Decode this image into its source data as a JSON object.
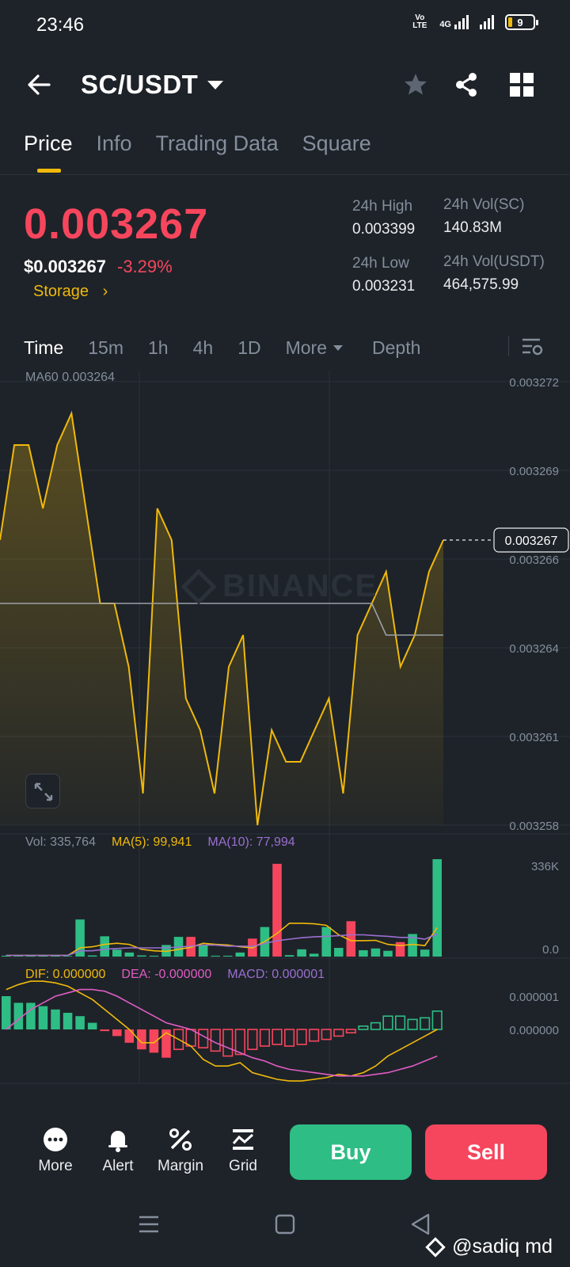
{
  "status_bar": {
    "time": "23:46",
    "network_volte": "Vo LTE",
    "network_type": "4G",
    "battery_level": "9"
  },
  "header": {
    "pair": "SC/USDT"
  },
  "tabs": [
    {
      "label": "Price",
      "active": true
    },
    {
      "label": "Info",
      "active": false
    },
    {
      "label": "Trading Data",
      "active": false
    },
    {
      "label": "Square",
      "active": false
    }
  ],
  "price": {
    "last": "0.003267",
    "usd_value": "$0.003267",
    "change_pct": "-3.29%",
    "tag": "Storage",
    "tag_arrow": "›",
    "high_label": "24h High",
    "high": "0.003399",
    "low_label": "24h Low",
    "low": "0.003231",
    "vol_base_label": "24h Vol(SC)",
    "vol_base": "140.83M",
    "vol_quote_label": "24h Vol(USDT)",
    "vol_quote": "464,575.99"
  },
  "intervals": {
    "items": [
      "Time",
      "15m",
      "1h",
      "4h",
      "1D"
    ],
    "more": "More",
    "depth": "Depth",
    "active": "Time"
  },
  "colors": {
    "background": "#1e2329",
    "up": "#2ebd85",
    "down": "#f6465d",
    "accent": "#f0b90b",
    "muted": "#848e9c",
    "ma_line": "#9aa0a8",
    "ma10": "#9b6fd1",
    "dea": "#e05cc4"
  },
  "chart_data": [
    {
      "type": "line",
      "name": "price",
      "legend": "MA60 0.003264",
      "watermark": "BINANCE",
      "ylim": [
        0.003258,
        0.003272
      ],
      "y_ticks": [
        "0.003272",
        "0.003269",
        "0.003266",
        "0.003264",
        "0.003261",
        "0.003258"
      ],
      "current_price_label": "0.003267",
      "current_price": 0.003267,
      "series": [
        {
          "values": [
            0.003267,
            0.00327,
            0.00327,
            0.003268,
            0.00327,
            0.003271,
            0.003268,
            0.003265,
            0.003265,
            0.003263,
            0.003259,
            0.003268,
            0.003267,
            0.003262,
            0.003261,
            0.003259,
            0.003263,
            0.003264,
            0.003258,
            0.003261,
            0.00326,
            0.00326,
            0.003261,
            0.003262,
            0.003259,
            0.003264,
            0.003265,
            0.003266,
            0.003263,
            0.003264,
            0.003266,
            0.003267
          ]
        },
        {
          "values": [
            0.003265,
            0.003265,
            0.003265,
            0.003265,
            0.003265,
            0.003265,
            0.003265,
            0.003265,
            0.003265,
            0.003265,
            0.003265,
            0.003265,
            0.003265,
            0.003265,
            0.003265,
            0.003265,
            0.003265,
            0.003265,
            0.003265,
            0.003265,
            0.003265,
            0.003265,
            0.003265,
            0.003265,
            0.003265,
            0.003265,
            0.003265,
            0.003264,
            0.003264,
            0.003264,
            0.003264,
            0.003264
          ]
        }
      ]
    },
    {
      "type": "bar",
      "name": "volume",
      "vol_label": "Vol: 335,764",
      "ma5_label": "MA(5): 99,941",
      "ma10_label": "MA(10): 77,994",
      "y_ticks": [
        "336K",
        "0.0"
      ],
      "ylim": [
        0,
        336000
      ],
      "values": [
        3000,
        2000,
        4000,
        3000,
        5000,
        2000,
        128000,
        4000,
        70000,
        24000,
        14000,
        4000,
        3000,
        40000,
        68000,
        68000,
        40000,
        3000,
        3000,
        14000,
        62000,
        102000,
        320000,
        5000,
        25000,
        10000,
        102000,
        30000,
        122000,
        22000,
        28000,
        20000,
        50000,
        78000,
        24000,
        336000
      ],
      "directions": [
        "up",
        "up",
        "up",
        "up",
        "up",
        "up",
        "up",
        "up",
        "up",
        "up",
        "up",
        "up",
        "up",
        "up",
        "up",
        "down",
        "up",
        "up",
        "up",
        "up",
        "down",
        "up",
        "down",
        "up",
        "up",
        "up",
        "up",
        "up",
        "down",
        "up",
        "up",
        "up",
        "down",
        "up",
        "up",
        "up"
      ],
      "series": [
        {
          "values": [
            4000,
            4000,
            4000,
            4000,
            4000,
            4000,
            30000,
            34000,
            42000,
            46000,
            42000,
            25000,
            20000,
            18000,
            25000,
            32000,
            46000,
            42000,
            40000,
            34000,
            30000,
            52000,
            80000,
            115000,
            115000,
            113000,
            108000,
            75000,
            55000,
            55000,
            56000,
            42000,
            38000,
            42000,
            38000,
            99941
          ]
        },
        {
          "values": [
            4000,
            4000,
            4000,
            4000,
            4000,
            4000,
            20000,
            20000,
            25000,
            28000,
            30000,
            30000,
            30000,
            30000,
            33000,
            36000,
            40000,
            40000,
            36000,
            36000,
            35000,
            45000,
            55000,
            60000,
            65000,
            68000,
            70000,
            72000,
            75000,
            75000,
            72000,
            70000,
            66000,
            66000,
            60000,
            77994
          ]
        }
      ]
    },
    {
      "type": "bar",
      "name": "macd",
      "dif_label": "DIF: 0.000000",
      "dea_label": "DEA: -0.000000",
      "macd_label": "MACD: 0.000001",
      "y_ticks": [
        "0.000001",
        "0.000000"
      ],
      "values": [
        1.0,
        0.8,
        0.8,
        0.7,
        0.6,
        0.5,
        0.4,
        0.2,
        -0.05,
        -0.2,
        -0.4,
        -0.6,
        -0.7,
        -0.85,
        -0.6,
        -0.5,
        -0.55,
        -0.65,
        -0.8,
        -0.75,
        -0.6,
        -0.5,
        -0.45,
        -0.5,
        -0.45,
        -0.35,
        -0.3,
        -0.2,
        -0.1,
        0.1,
        0.2,
        0.4,
        0.4,
        0.3,
        0.35,
        0.55
      ],
      "series": [
        {
          "values": [
            1.2,
            1.35,
            1.45,
            1.45,
            1.4,
            1.3,
            1.1,
            0.9,
            0.6,
            0.3,
            0.0,
            -0.4,
            -0.4,
            -0.1,
            -0.3,
            -0.5,
            -0.9,
            -1.1,
            -1.1,
            -1.0,
            -1.3,
            -1.4,
            -1.5,
            -1.55,
            -1.55,
            -1.5,
            -1.45,
            -1.35,
            -1.4,
            -1.3,
            -1.1,
            -0.8,
            -0.6,
            -0.4,
            -0.2,
            0.0
          ]
        },
        {
          "values": [
            0.0,
            0.3,
            0.6,
            0.8,
            1.0,
            1.1,
            1.2,
            1.2,
            1.15,
            1.0,
            0.8,
            0.6,
            0.4,
            0.2,
            0.1,
            0.0,
            -0.2,
            -0.4,
            -0.55,
            -0.7,
            -0.85,
            -0.95,
            -1.1,
            -1.2,
            -1.25,
            -1.3,
            -1.35,
            -1.4,
            -1.4,
            -1.4,
            -1.35,
            -1.3,
            -1.2,
            -1.1,
            -0.95,
            -0.8
          ]
        }
      ]
    }
  ],
  "bottom_actions": [
    {
      "label": "More"
    },
    {
      "label": "Alert"
    },
    {
      "label": "Margin"
    },
    {
      "label": "Grid"
    }
  ],
  "trade": {
    "buy": "Buy",
    "sell": "Sell"
  },
  "watermark_text": "@sadiq md"
}
